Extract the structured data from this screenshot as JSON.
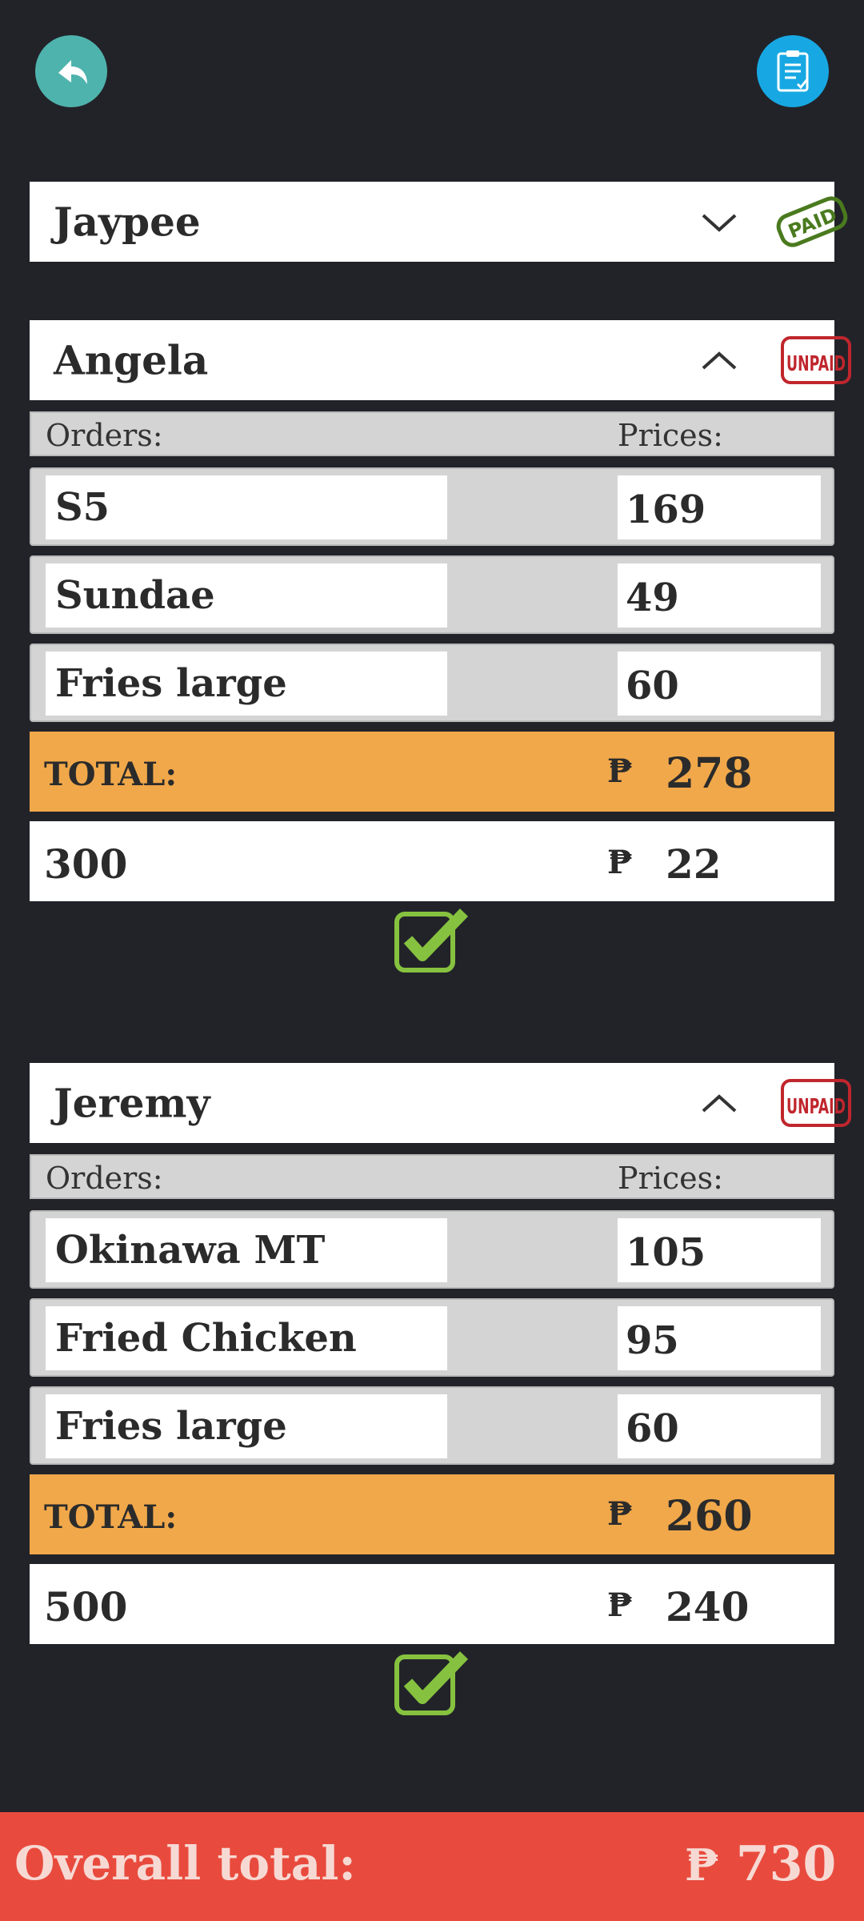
{
  "icons": {
    "back": "back-arrow-icon",
    "clipboard": "clipboard-check-icon",
    "checkbox": "checkbox-checked-icon"
  },
  "colors": {
    "background": "#222329",
    "total_bar": "#f1a84a",
    "footer": "#e84b3d",
    "paid_stamp": "#4a7a1e",
    "unpaid_stamp": "#c0262d",
    "check": "#86c23f"
  },
  "people": [
    {
      "name": "Jaypee",
      "stamp": "PAID",
      "expanded": false
    },
    {
      "name": "Angela",
      "stamp": "UNPAID",
      "expanded": true,
      "orders_label": "Orders:",
      "prices_label": "Prices:",
      "orders": [
        {
          "item": "S5",
          "price": "169"
        },
        {
          "item": "Sundae",
          "price": "49"
        },
        {
          "item": "Fries large",
          "price": "60"
        }
      ],
      "total_label": "TOTAL:",
      "currency": "₱",
      "total": "278",
      "paid_amount": "300",
      "change": "22"
    },
    {
      "name": "Jeremy",
      "stamp": "UNPAID",
      "expanded": true,
      "orders_label": "Orders:",
      "prices_label": "Prices:",
      "orders": [
        {
          "item": "Okinawa MT",
          "price": "105"
        },
        {
          "item": "Fried Chicken",
          "price": "95"
        },
        {
          "item": "Fries large",
          "price": "60"
        }
      ],
      "total_label": "TOTAL:",
      "currency": "₱",
      "total": "260",
      "paid_amount": "500",
      "change": "240"
    }
  ],
  "footer": {
    "label": "Overall total:",
    "currency": "₱",
    "value": "730"
  }
}
